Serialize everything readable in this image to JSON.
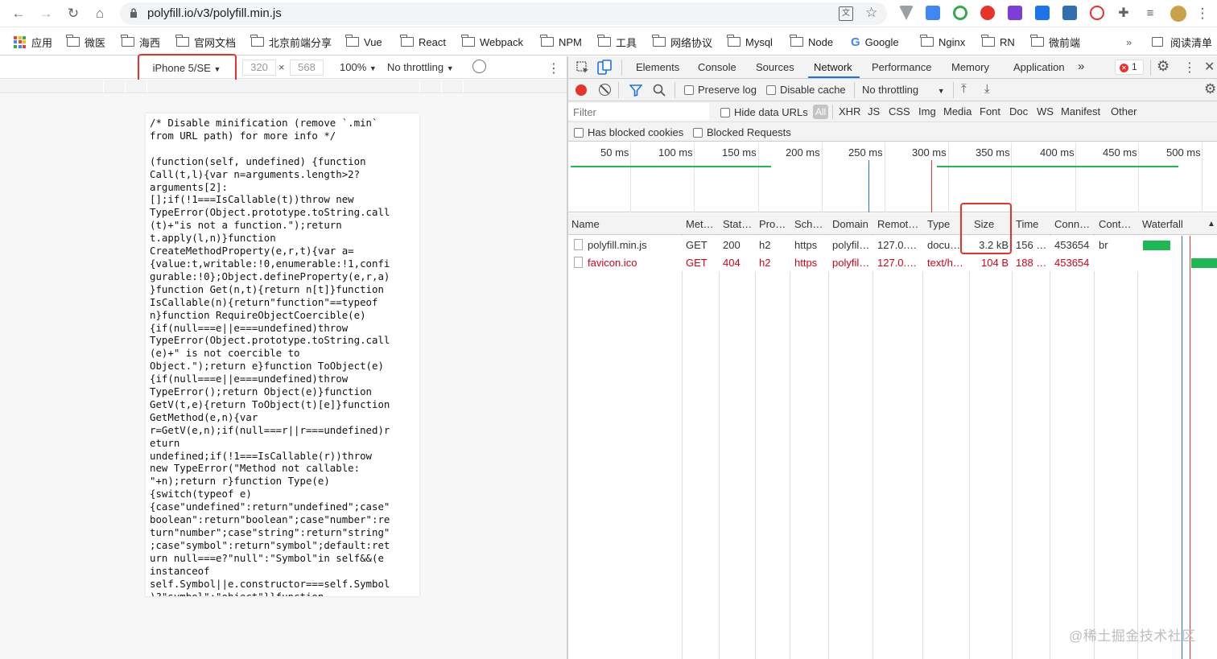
{
  "browser": {
    "url": "polyfill.io/v3/polyfill.min.js"
  },
  "bookmarks": [
    {
      "label": "应用",
      "icon": "apps-grid-icon"
    },
    {
      "label": "微医",
      "icon": "folder-icon"
    },
    {
      "label": "海西",
      "icon": "folder-icon"
    },
    {
      "label": "官网文档",
      "icon": "folder-icon"
    },
    {
      "label": "北京前端分享",
      "icon": "folder-icon"
    },
    {
      "label": "Vue",
      "icon": "folder-icon"
    },
    {
      "label": "React",
      "icon": "folder-icon"
    },
    {
      "label": "Webpack",
      "icon": "folder-icon"
    },
    {
      "label": "NPM",
      "icon": "folder-icon"
    },
    {
      "label": "工具",
      "icon": "folder-icon"
    },
    {
      "label": "网络协议",
      "icon": "folder-icon"
    },
    {
      "label": "Mysql",
      "icon": "folder-icon"
    },
    {
      "label": "Node",
      "icon": "folder-icon"
    },
    {
      "label": "Google",
      "icon": "google-icon"
    },
    {
      "label": "Nginx",
      "icon": "folder-icon"
    },
    {
      "label": "RN",
      "icon": "folder-icon"
    },
    {
      "label": "微前端",
      "icon": "folder-icon"
    }
  ],
  "bookmarks_more": "»",
  "reading_list": "阅读清单",
  "device_toolbar": {
    "device": "iPhone 5/SE",
    "width": "320",
    "times": "×",
    "height": "568",
    "zoom": "100%",
    "throttling": "No throttling"
  },
  "page_code": "/* Disable minification (remove `.min`\nfrom URL path) for more info */\n\n(function(self, undefined) {function\nCall(t,l){var n=arguments.length>2?\narguments[2]:\n[];if(!1===IsCallable(t))throw new\nTypeError(Object.prototype.toString.call\n(t)+\"is not a function.\");return\nt.apply(l,n)}function\nCreateMethodProperty(e,r,t){var a=\n{value:t,writable:!0,enumerable:!1,confi\ngurable:!0};Object.defineProperty(e,r,a)\n}function Get(n,t){return n[t]}function\nIsCallable(n){return\"function\"==typeof\nn}function RequireObjectCoercible(e)\n{if(null===e||e===undefined)throw\nTypeError(Object.prototype.toString.call\n(e)+\" is not coercible to\nObject.\");return e}function ToObject(e)\n{if(null===e||e===undefined)throw\nTypeError();return Object(e)}function\nGetV(t,e){return ToObject(t)[e]}function\nGetMethod(e,n){var\nr=GetV(e,n);if(null===r||r===undefined)r\neturn\nundefined;if(!1===IsCallable(r))throw\nnew TypeError(\"Method not callable:\n\"+n);return r}function Type(e)\n{switch(typeof e)\n{case\"undefined\":return\"undefined\";case\"\nboolean\":return\"boolean\";case\"number\":re\nturn\"number\";case\"string\":return\"string\"\n;case\"symbol\":return\"symbol\";default:ret\nurn null===e?\"null\":\"Symbol\"in self&&(e\ninstanceof\nself.Symbol||e.constructor===self.Symbol\n)?\"symbol\":\"object\"}}function",
  "devtools": {
    "tabs": [
      "Elements",
      "Console",
      "Sources",
      "Network",
      "Performance",
      "Memory",
      "Application"
    ],
    "active_tab": "Network",
    "more_tabs": "»",
    "error_count": "1",
    "network_toolbar": {
      "preserve_log": "Preserve log",
      "disable_cache": "Disable cache",
      "throttling": "No throttling"
    },
    "filter": {
      "placeholder": "Filter",
      "hide_data_urls": "Hide data URLs",
      "types": [
        "All",
        "XHR",
        "JS",
        "CSS",
        "Img",
        "Media",
        "Font",
        "Doc",
        "WS",
        "Manifest",
        "Other"
      ],
      "active_type": "All"
    },
    "blocked": {
      "has_blocked_cookies": "Has blocked cookies",
      "blocked_requests": "Blocked Requests"
    },
    "timeline_ticks": [
      "50 ms",
      "100 ms",
      "150 ms",
      "200 ms",
      "250 ms",
      "300 ms",
      "350 ms",
      "400 ms",
      "450 ms",
      "500 ms"
    ],
    "columns": [
      "Name",
      "Met…",
      "Stat…",
      "Pro…",
      "Sch…",
      "Domain",
      "Remot…",
      "Type",
      "Size",
      "Time",
      "Conn…",
      "Cont…",
      "Waterfall"
    ],
    "sort_indicator": "▲",
    "rows": [
      {
        "name": "polyfill.min.js",
        "method": "GET",
        "status": "200",
        "protocol": "h2",
        "scheme": "https",
        "domain": "polyfil…",
        "remote": "127.0.…",
        "type": "docu…",
        "size": "3.2 kB",
        "time": "156 …",
        "connection": "453654",
        "content": "br",
        "error": false
      },
      {
        "name": "favicon.ico",
        "method": "GET",
        "status": "404",
        "protocol": "h2",
        "scheme": "https",
        "domain": "polyfil…",
        "remote": "127.0.…",
        "type": "text/h…",
        "size": "104 B",
        "time": "188 …",
        "connection": "453654",
        "content": "",
        "error": true
      }
    ]
  },
  "watermark": "@稀土掘金技术社区",
  "colors": {
    "highlight_box": "#e8332c",
    "record_button": "#e8332c",
    "error_row_text": "#d0021b",
    "waterfall_bar": "#1db954",
    "accent_blue": "#1a73e8"
  }
}
